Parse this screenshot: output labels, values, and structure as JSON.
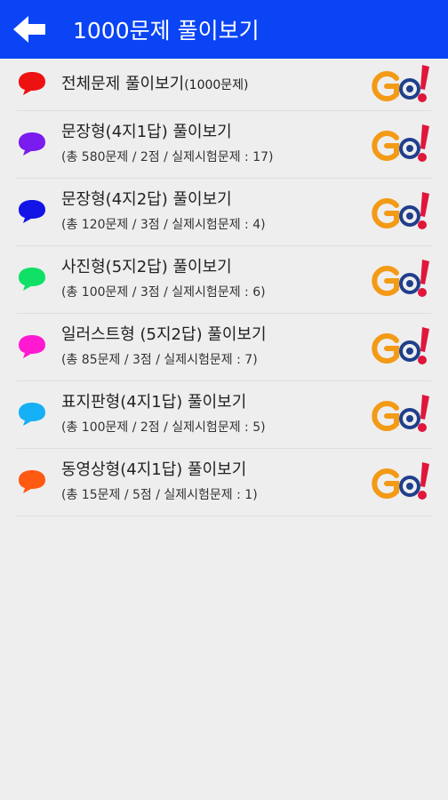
{
  "header": {
    "title": "1000문제 풀이보기",
    "back_icon": "arrow-left-icon",
    "color": "#0a44f5"
  },
  "items": [
    {
      "title": "전체문제 풀이보기",
      "title_suffix": "(1000문제)",
      "subtitle": "",
      "color": "#ee1111"
    },
    {
      "title": "문장형(4지1답) 풀이보기",
      "title_suffix": "",
      "subtitle": "(총 580문제 / 2점 / 실제시험문제 : 17)",
      "color": "#7a1cf0"
    },
    {
      "title": "문장형(4지2답) 풀이보기",
      "title_suffix": "",
      "subtitle": "(총 120문제 / 3점 / 실제시험문제 : 4)",
      "color": "#1414e6"
    },
    {
      "title": "사진형(5지2답) 풀이보기",
      "title_suffix": "",
      "subtitle": "(총 100문제 / 3점 / 실제시험문제 : 6)",
      "color": "#11e066"
    },
    {
      "title": "일러스트형 (5지2답) 풀이보기",
      "title_suffix": "",
      "subtitle": "(총 85문제 / 3점 / 실제시험문제 : 7)",
      "color": "#ff1ad2"
    },
    {
      "title": "표지판형(4지1답) 풀이보기",
      "title_suffix": "",
      "subtitle": "(총 100문제 / 2점 / 실제시험문제 : 5)",
      "color": "#15b0f5"
    },
    {
      "title": "동영상형(4지1답) 풀이보기",
      "title_suffix": "",
      "subtitle": "(총 15문제 / 5점 / 실제시험문제 : 1)",
      "color": "#ff5a12"
    }
  ],
  "go_button": {
    "text": "GO!",
    "icon": "go-icon",
    "colors": {
      "g": "#f39a16",
      "o": "#1f3f8c",
      "exclaim": "#e0163b"
    }
  }
}
